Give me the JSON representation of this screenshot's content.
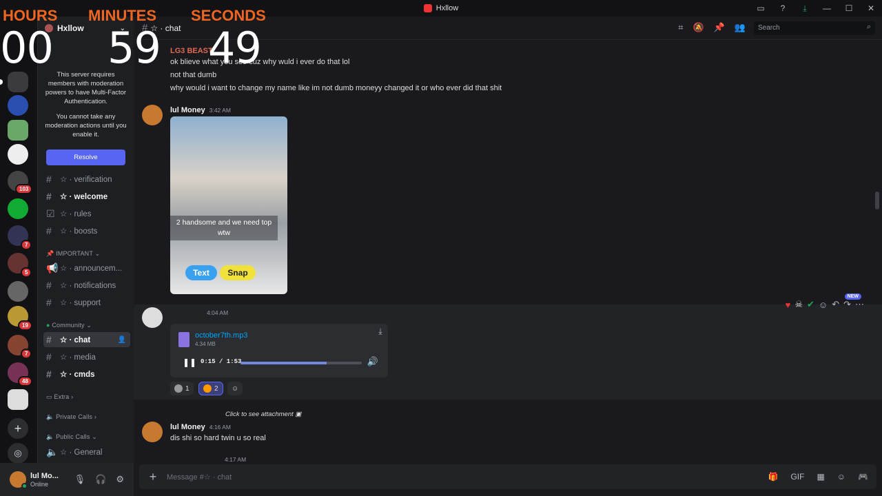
{
  "window": {
    "title": "Hxllow"
  },
  "timer": {
    "hours_label": "HOURS",
    "minutes_label": "MINUTES",
    "seconds_label": "SECONDS",
    "hours": "00",
    "minutes": "59",
    "seconds": "49"
  },
  "guilds": {
    "badges": [
      "103",
      "7",
      "5",
      "19",
      "7",
      "48"
    ]
  },
  "server": {
    "name": "Hxllow",
    "mfa_line1": "This server requires members with moderation powers to have Multi-Factor Authentication.",
    "mfa_line2": "You cannot take any moderation actions until you enable it.",
    "resolve": "Resolve"
  },
  "channels": {
    "verification": "☆ · verification",
    "welcome": "☆ · welcome",
    "rules": "☆ · rules",
    "boosts": "☆ · boosts",
    "cat_important": "IMPORTANT",
    "announcements": "☆ · announcem...",
    "notifications": "☆ · notifications",
    "support": "☆ · support",
    "cat_community": "Community",
    "chat": "☆ · chat",
    "media": "☆ · media",
    "cmds": "☆ · cmds",
    "cat_extra": "Extra",
    "cat_private": "Private Calls",
    "cat_public": "Public Calls",
    "general": "☆ · General"
  },
  "user": {
    "name": "lul Mo...",
    "status": "Online"
  },
  "topbar": {
    "channel": "☆ · chat",
    "search_placeholder": "Search"
  },
  "messages": {
    "m1_author": "LG3 BEAST",
    "m1_line1": "ok blieve what you see cuz why wuld i ever do that lol",
    "m1_line2": "not that dumb",
    "m1_line3": "why would i want to change my name like im not dumb moneyy changed it or who ever did that shit",
    "m2_author": "lul Money",
    "m2_time": "3:42 AM",
    "video_caption": "2 handsome and we need top wtw",
    "video_btn1": "Text",
    "video_btn2": "Snap",
    "m3_time": "4:04 AM",
    "file_name": "october7th.mp3",
    "file_size": "4.34 MB",
    "audio_time": "0:15 / 1:53",
    "audio_progress": 0.71,
    "react1_count": "1",
    "react2_count": "2",
    "new_badge": "NEW",
    "reply_text": "Click to see attachment",
    "m4_author": "lul Money",
    "m4_time": "4:16 AM",
    "m4_text": "dis shi so hard twin u so real",
    "m5_time": "4:17 AM"
  },
  "composer": {
    "placeholder": "Message #☆ · chat"
  }
}
